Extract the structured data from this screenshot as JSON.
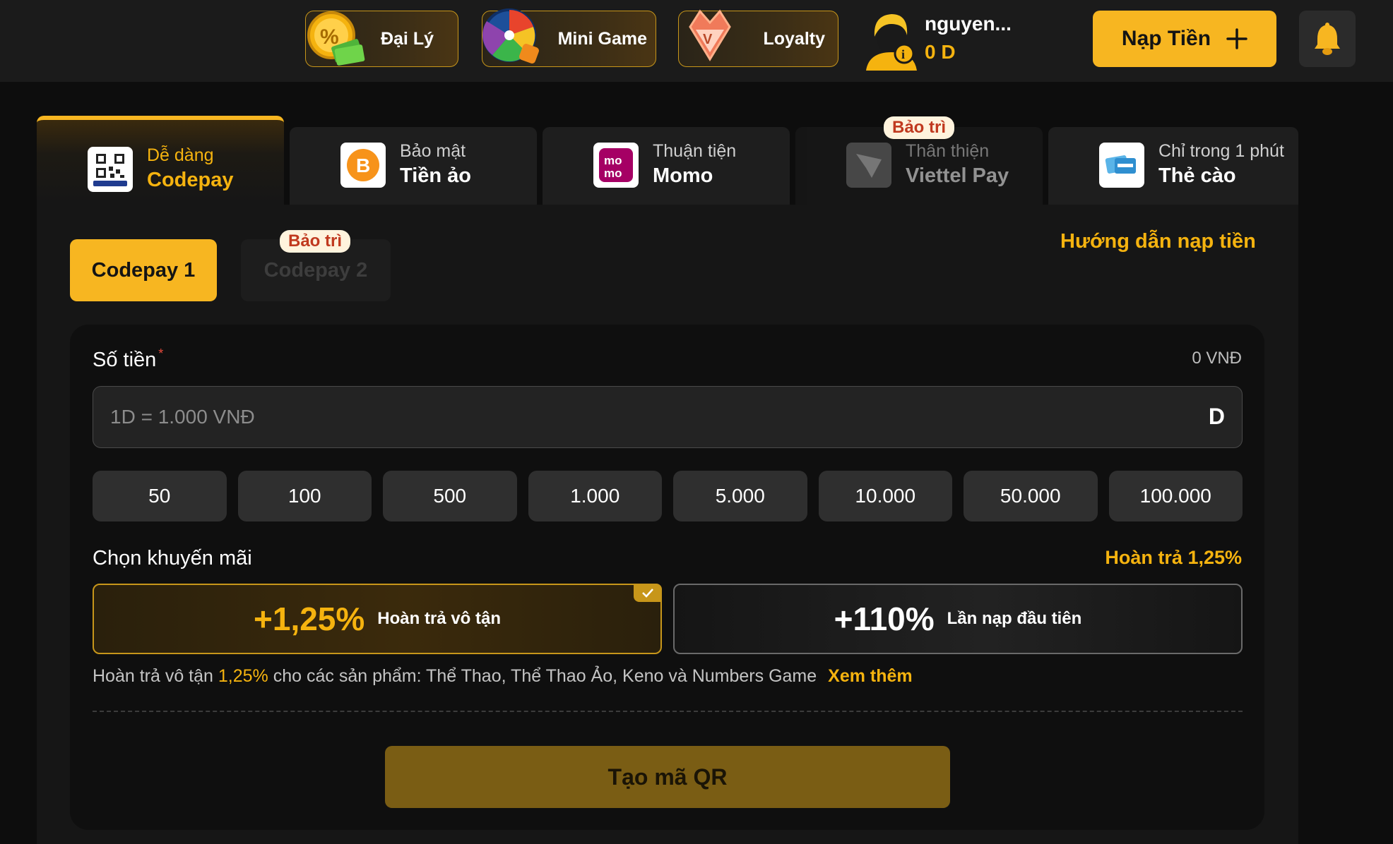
{
  "header": {
    "nav": [
      {
        "label": "Đại Lý",
        "icon": "agent-coin-icon"
      },
      {
        "label": "Mini Game",
        "icon": "spin-wheel-icon"
      },
      {
        "label": "Loyalty",
        "icon": "diamond-icon"
      }
    ],
    "user": {
      "name": "nguyen...",
      "balance": "0 D",
      "icon": "user-avatar-icon"
    },
    "topup_label": "Nạp Tiền",
    "topup_icon": "plus-icon",
    "bell_icon": "bell-icon"
  },
  "methods": [
    {
      "sub": "Dễ dàng",
      "main": "Codepay",
      "icon": "qr-codepay-icon",
      "active": true
    },
    {
      "sub": "Bảo mật",
      "main": "Tiền ảo",
      "icon": "bitcoin-icon"
    },
    {
      "sub": "Thuận tiện",
      "main": "Momo",
      "icon": "momo-icon"
    },
    {
      "sub": "Thân thiện",
      "main": "Viettel Pay",
      "icon": "viettel-pay-icon",
      "badge": "Bảo trì",
      "disabled": true
    },
    {
      "sub": "Chỉ trong 1 phút",
      "main": "Thẻ cào",
      "icon": "scratch-card-icon"
    }
  ],
  "subtabs": [
    {
      "label": "Codepay 1",
      "active": true
    },
    {
      "label": "Codepay 2",
      "badge": "Bảo trì",
      "disabled": true
    }
  ],
  "guide_link": "Hướng dẫn nạp tiền",
  "form": {
    "amount_label": "Số tiền",
    "required_mark": "*",
    "amount_display": "0 VNĐ",
    "input_placeholder": "1D = 1.000 VNĐ",
    "input_value": "",
    "input_unit": "D",
    "quick_amounts": [
      "50",
      "100",
      "500",
      "1.000",
      "5.000",
      "10.000",
      "50.000",
      "100.000"
    ]
  },
  "promo": {
    "title": "Chọn khuyến mãi",
    "selected_summary": "Hoàn trả 1,25%",
    "options": [
      {
        "pct": "+1,25%",
        "desc": "Hoàn trả vô tận",
        "selected": true
      },
      {
        "pct": "+110%",
        "desc": "Lần nạp đầu tiên",
        "selected": false
      }
    ],
    "note_prefix": "Hoàn trả vô tận ",
    "note_highlight": "1,25%",
    "note_suffix": " cho các sản phẩm: Thể Thao, Thể Thao Ảo, Keno và Numbers Game",
    "see_more": "Xem thêm"
  },
  "submit_label": "Tạo mã QR",
  "colors": {
    "accent": "#f7b621",
    "background": "#0d0d0d",
    "panel": "#161616"
  }
}
